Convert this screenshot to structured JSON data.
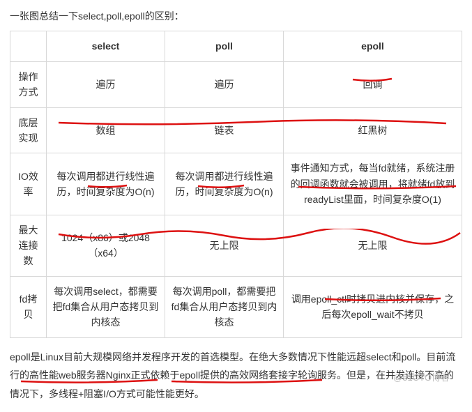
{
  "intro": "一张图总结一下select,poll,epoll的区别：",
  "table": {
    "headers": [
      "",
      "select",
      "poll",
      "epoll"
    ],
    "rows": [
      {
        "label": "操作方式",
        "select": "遍历",
        "poll": "遍历",
        "epoll": "回调"
      },
      {
        "label": "底层实现",
        "select": "数组",
        "poll": "链表",
        "epoll": "红黑树"
      },
      {
        "label": "IO效率",
        "select": "每次调用都进行线性遍历，时间复杂度为O(n)",
        "poll": "每次调用都进行线性遍历，时间复杂度为O(n)",
        "epoll": "事件通知方式，每当fd就绪，系统注册的回调函数就会被调用，将就绪fd放到readyList里面，时间复杂度O(1)"
      },
      {
        "label": "最大连接数",
        "select": "1024（x86）或2048（x64）",
        "poll": "无上限",
        "epoll": "无上限"
      },
      {
        "label": "fd拷贝",
        "select": "每次调用select，都需要把fd集合从用户态拷贝到内核态",
        "poll": "每次调用poll，都需要把fd集合从用户态拷贝到内核态",
        "epoll": "调用epoll_ctl时拷贝进内核并保存，之后每次epoll_wait不拷贝"
      }
    ]
  },
  "paragraph": "epoll是Linux目前大规模网络并发程序开发的首选模型。在绝大多数情况下性能远超select和poll。目前流行的高性能web服务器Nginx正式依赖于epoll提供的高效网络套接字轮询服务。但是，在并发连接不高的情况下，多线程+阻塞I/O方式可能性能更好。",
  "watermark": "@51CTO博客"
}
